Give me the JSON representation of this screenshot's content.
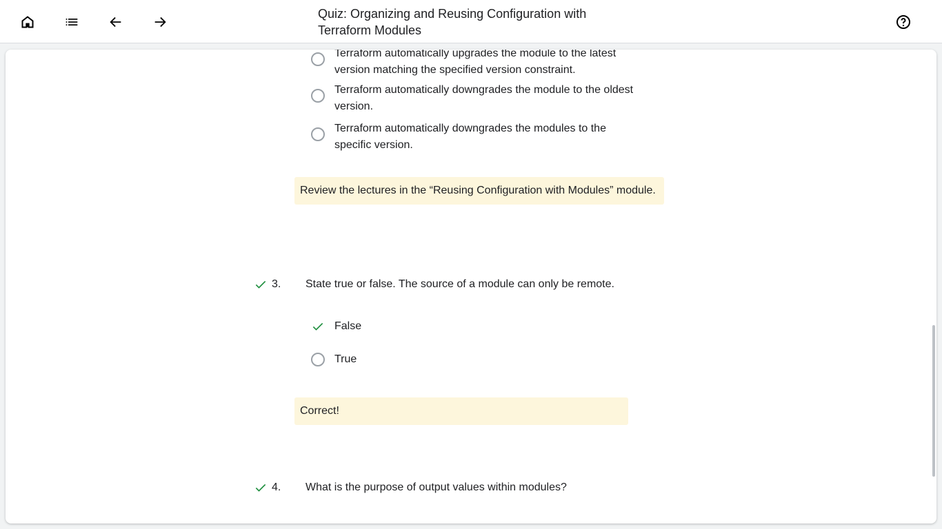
{
  "header": {
    "title": "Quiz: Organizing and Reusing Configuration with Terraform Modules",
    "icons": [
      "home-icon",
      "list-icon",
      "arrow-back-icon",
      "arrow-forward-icon",
      "help-icon"
    ]
  },
  "q2": {
    "options": [
      "Terraform automatically upgrades the module to the latest version matching the specified version constraint.",
      "Terraform automatically downgrades the module to the oldest version.",
      "Terraform automatically downgrades the modules to the specific version."
    ],
    "feedback": "Review the lectures in the “Reusing Configuration with Modules” module."
  },
  "q3": {
    "number": "3.",
    "text": "State true or false. The source of a module can only be remote.",
    "options": [
      "False",
      "True"
    ],
    "feedback": "Correct!"
  },
  "q4": {
    "number": "4.",
    "text": "What is the purpose of output values within modules?"
  },
  "colors": {
    "correct": "#1e8e3e",
    "feedback_bg": "#fdf6dc"
  }
}
